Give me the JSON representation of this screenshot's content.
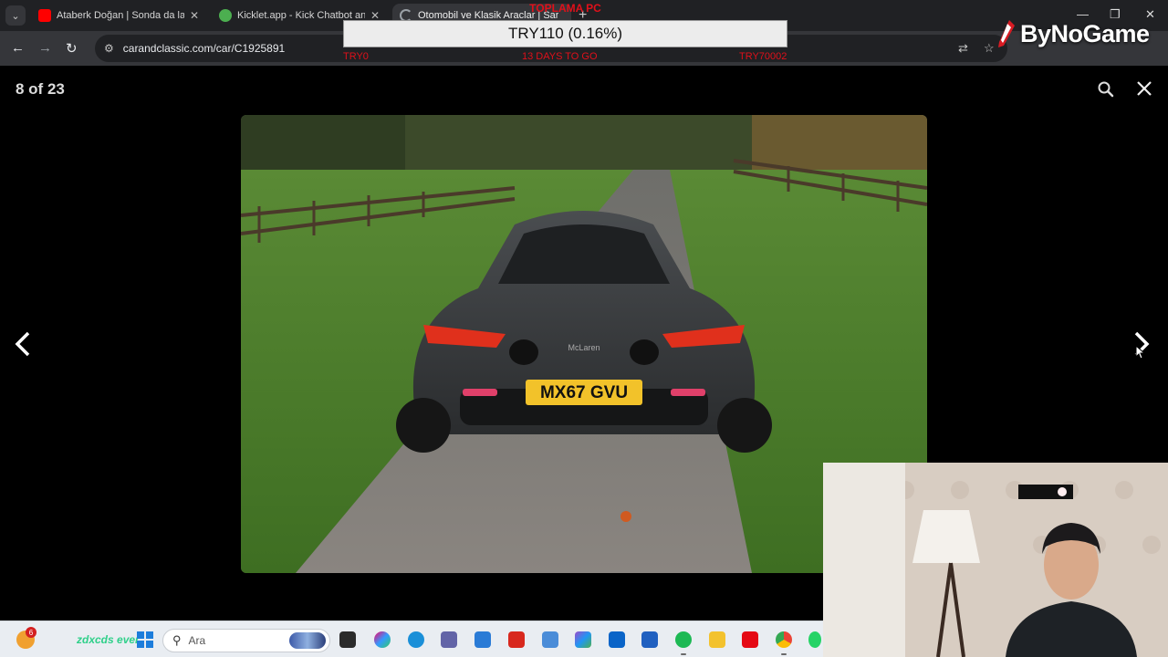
{
  "browser": {
    "tabs": [
      {
        "title": "Ataberk Doğan | Sonda da lafı l",
        "favicon": "youtube-icon",
        "color": "#ff0000",
        "active": false
      },
      {
        "title": "Kicklet.app - Kick Chatbot and",
        "favicon": "kicklet-icon",
        "color": "#4caf50",
        "active": false
      },
      {
        "title": "Otomobil ve Klasik Araclar | Sar",
        "favicon": "loading-icon",
        "color": "#9aa0a6",
        "active": true
      }
    ],
    "new_tab_label": "+",
    "url": "carandclassic.com/car/C1925891"
  },
  "donation": {
    "heading": "TOPLAMA PC",
    "amount": "TRY110 (0.16%)",
    "left": "TRY0",
    "center": "13 DAYS TO GO",
    "right": "TRY70002"
  },
  "brand": {
    "name": "ByNoGame"
  },
  "gallery": {
    "counter": "8 of 23",
    "plate": "MX67 GVU",
    "car_badge": "McLaren"
  },
  "taskbar": {
    "badge_count": "6",
    "widget_text": "zdxcds ever",
    "search_placeholder": "Ara"
  },
  "colors": {
    "chrome_dark": "#202124",
    "chrome_mid": "#35363a",
    "donation_red": "#e0101a"
  }
}
